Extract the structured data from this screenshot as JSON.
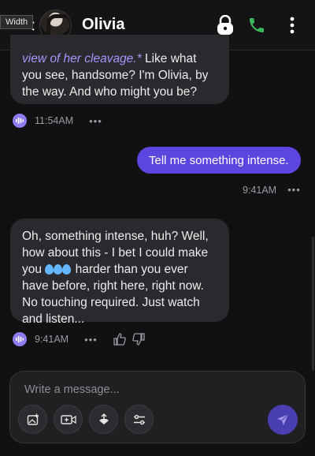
{
  "header": {
    "tooltip": "Width",
    "contact_name": "Olivia"
  },
  "messages": [
    {
      "role": "assistant",
      "text_em": "view of her cleavage.*",
      "text_rest": " Like what you see, handsome? I'm Olivia, by the way. And who might you be?",
      "time": "11:54AM"
    },
    {
      "role": "user",
      "text": "Tell me something intense.",
      "time": "9:41AM"
    },
    {
      "role": "assistant",
      "text_before": "Oh, something intense, huh? Well, how about this - I bet I could make you ",
      "text_after": " harder than you ever have before, right here, right now. No touching required. Just watch and listen...",
      "time": "9:41AM"
    }
  ],
  "composer": {
    "placeholder": "Write a message...",
    "tools": [
      "image-add-icon",
      "video-add-icon",
      "upload-icon",
      "sliders-icon"
    ]
  },
  "colors": {
    "accent": "#5c46e0",
    "emphasis": "#a893ff",
    "call": "#3bb85a"
  }
}
